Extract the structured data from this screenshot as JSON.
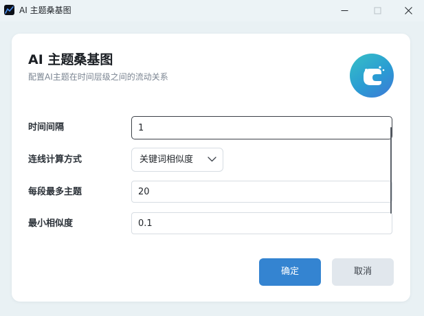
{
  "window": {
    "title": "AI 主题桑基图",
    "icon": "chart-line-icon",
    "controls": [
      "minimize-icon",
      "maximize-icon",
      "close-icon"
    ]
  },
  "dialog": {
    "title": "AI 主题桑基图",
    "subtitle": "配置AI主题在时间层级之间的流动关系",
    "logo": "ai-brain-icon"
  },
  "form": {
    "time_interval": {
      "label": "时间间隔",
      "value": "1"
    },
    "link_method": {
      "label": "连线计算方式",
      "selected": "关键词相似度"
    },
    "max_topics": {
      "label": "每段最多主题",
      "value": "20"
    },
    "min_similarity": {
      "label": "最小相似度",
      "value": "0.1"
    }
  },
  "buttons": {
    "confirm": "确定",
    "cancel": "取消"
  },
  "colors": {
    "primary": "#3484d1",
    "secondary": "#e1e7ed",
    "window_bg": "#e9f1f4",
    "card_bg": "#ffffff"
  }
}
